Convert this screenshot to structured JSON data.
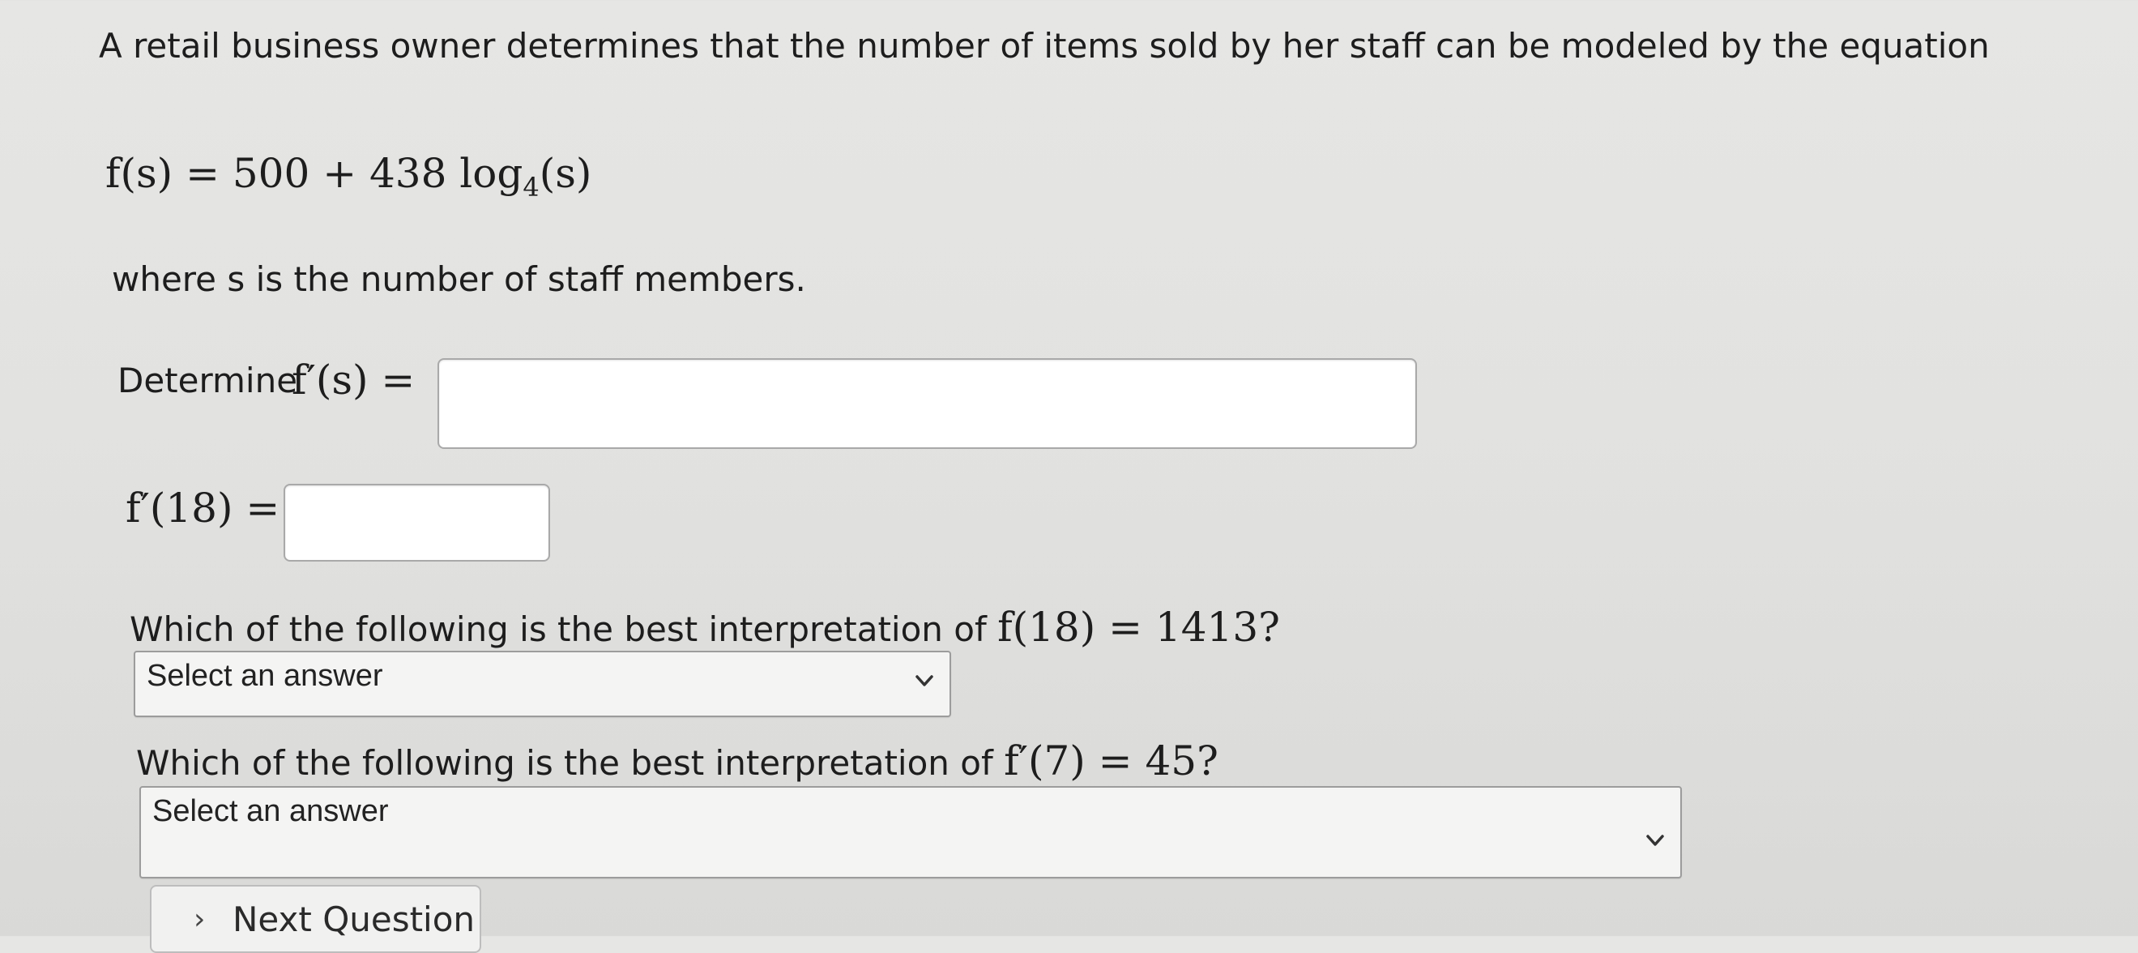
{
  "problem": {
    "intro": "A retail business owner determines that the number of items sold by her staff can be modeled by the equation",
    "equation": {
      "lhs": "f(s) = 500 + 438 log",
      "base": "4",
      "rhs": "(s)"
    },
    "where": "where s is the number of staff members.",
    "determine_label": "Determine",
    "determine_math": "f′(s) =",
    "f18_math": "f′(18) =",
    "question1": "Which of the following is the best interpretation of",
    "question1_math": "f(18) = 1413?",
    "question2": "Which of the following is the best interpretation of",
    "question2_math": "f′(7) = 45?"
  },
  "inputs": {
    "derivative_value": "",
    "f18_value": ""
  },
  "selects": {
    "q1_selected": "Select an answer",
    "q2_selected": "Select an answer"
  },
  "buttons": {
    "next_label": "Next Question",
    "next_icon": "chevron-right-icon"
  }
}
